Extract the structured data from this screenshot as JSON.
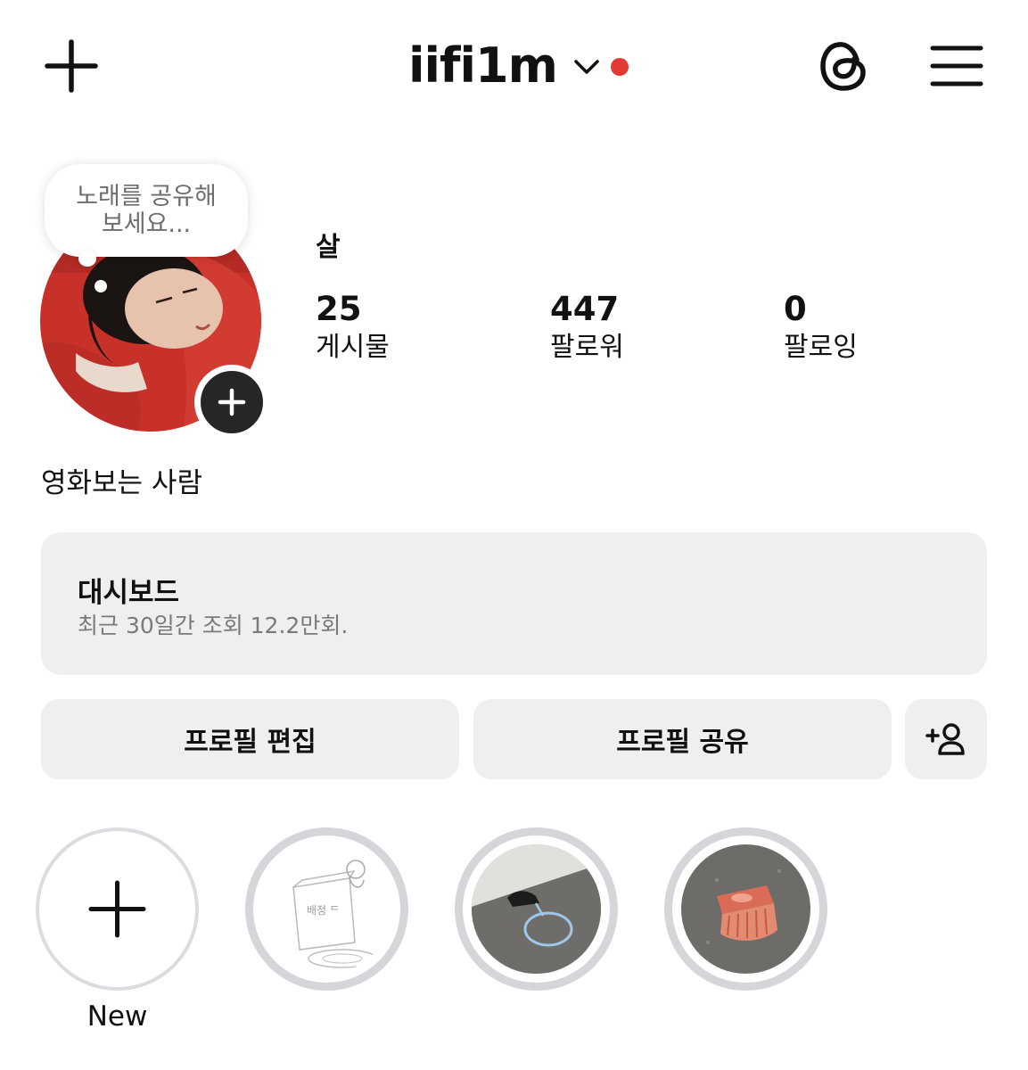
{
  "header": {
    "username": "iifi1m",
    "add_icon": "plus-icon",
    "threads_icon": "threads-icon",
    "menu_icon": "hamburger-menu-icon",
    "notification_color": "#e53935"
  },
  "note_bubble": {
    "line1": "노래를 공유해",
    "line2": "보세요..."
  },
  "profile": {
    "display_name": "살",
    "bio": "영화보는 사람",
    "stats": [
      {
        "value": "25",
        "label": "게시물"
      },
      {
        "value": "447",
        "label": "팔로워"
      },
      {
        "value": "0",
        "label": "팔로잉"
      }
    ]
  },
  "dashboard": {
    "title": "대시보드",
    "subtitle": "최근 30일간 조회 12.2만회."
  },
  "actions": {
    "edit_profile": "프로필 편집",
    "share_profile": "프로필 공유",
    "discover_icon": "add-person-icon"
  },
  "highlights": {
    "new_label": "New",
    "items": [
      "new-highlight",
      "highlight-sketch",
      "highlight-shoe",
      "highlight-object"
    ]
  }
}
